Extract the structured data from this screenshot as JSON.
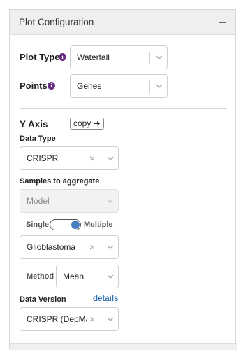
{
  "panel": {
    "title": "Plot Configuration"
  },
  "plot_type": {
    "label": "Plot Type",
    "info_icon": "i",
    "value": "Waterfall"
  },
  "points": {
    "label": "Points",
    "info_icon": "i",
    "value": "Genes"
  },
  "y_axis": {
    "title": "Y Axis",
    "copy_label": "copy ➜",
    "data_type": {
      "label": "Data Type",
      "value": "CRISPR",
      "clear": "×"
    },
    "samples": {
      "label": "Samples to aggregate",
      "value": "Model",
      "disabled": true
    },
    "toggle": {
      "left_label": "Single",
      "right_label": "Multiple",
      "state": "Multiple"
    },
    "context": {
      "value": "Glioblastoma",
      "clear": "×"
    },
    "method": {
      "label": "Method",
      "value": "Mean"
    },
    "data_version": {
      "label": "Data Version",
      "details_link": "details",
      "value": "CRISPR (DepMa...",
      "clear": "×"
    }
  },
  "colors": {
    "info": "#6b2f86",
    "toggle_knob": "#4a7ec0",
    "link": "#2f6fb0"
  }
}
